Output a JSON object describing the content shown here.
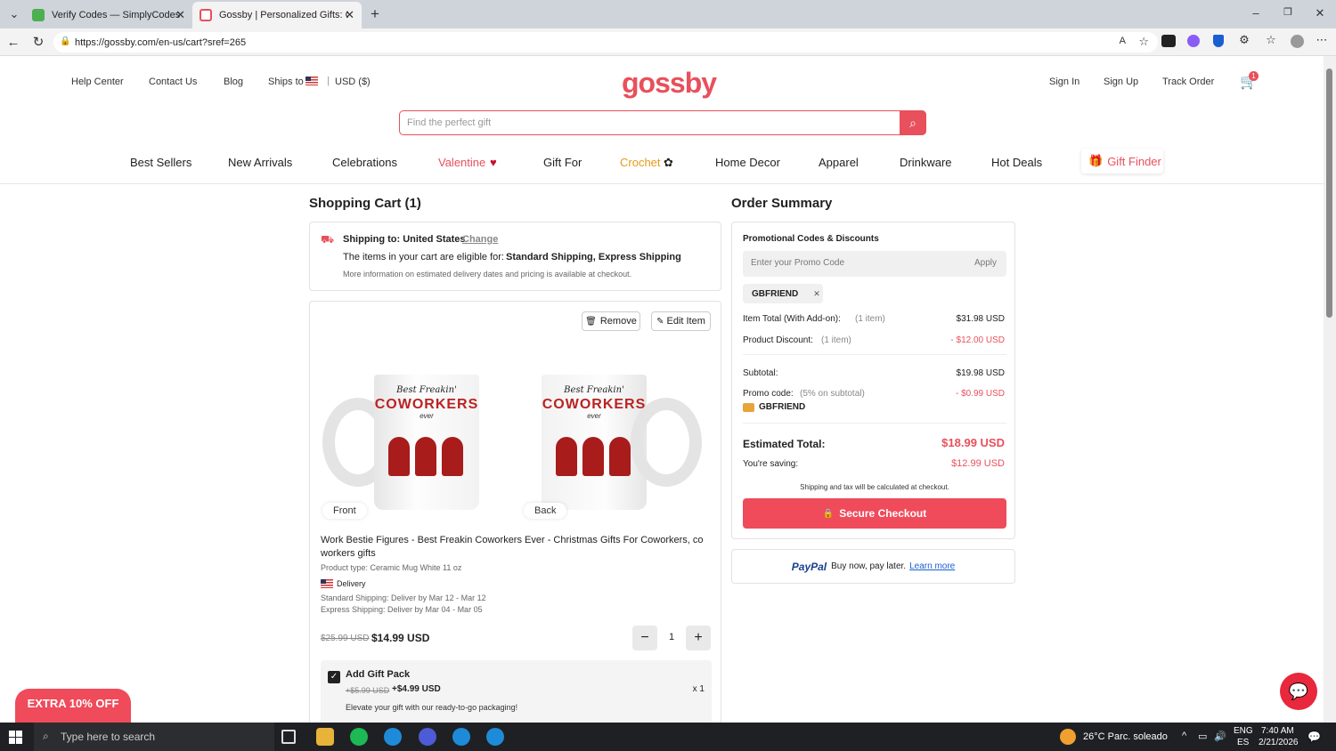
{
  "browser": {
    "tabs": [
      {
        "title": "Verify Codes — SimplyCodes"
      },
      {
        "title": "Gossby | Personalized Gifts: Custo"
      }
    ],
    "url": "https://gossby.com/en-us/cart?sref=265"
  },
  "header": {
    "links": [
      "Help Center",
      "Contact Us",
      "Blog"
    ],
    "ships_to": "Ships to",
    "currency": "USD ($)",
    "logo": "gossby",
    "account": [
      "Sign In",
      "Sign Up",
      "Track Order"
    ],
    "cart_count": "1",
    "search_placeholder": "Find the perfect gift"
  },
  "nav": {
    "items": [
      "Best Sellers",
      "New Arrivals",
      "Celebrations",
      "Valentine",
      "Gift For",
      "Crochet",
      "Home Decor",
      "Apparel",
      "Drinkware",
      "Hot Deals"
    ],
    "gift_finder": "Gift Finder"
  },
  "cart": {
    "title": "Shopping Cart (1)",
    "shipping_label": "Shipping to: United States",
    "change": "Change",
    "eligible_prefix": "The items in your cart are eligible for:",
    "eligible_methods": "Standard Shipping, Express Shipping",
    "more_info": "More information on estimated delivery dates and pricing is available at checkout.",
    "remove": "Remove",
    "edit": "Edit Item",
    "front": "Front",
    "back": "Back",
    "mug_text1": "Best Freakin'",
    "mug_text2": "COWORKERS",
    "mug_text3": "ever",
    "product_name": "Work Bestie Figures - Best Freakin Coworkers Ever - Christmas Gifts For Coworkers, co workers gifts",
    "product_type": "Product type: Ceramic Mug White 11 oz",
    "delivery": "Delivery",
    "standard": "Standard Shipping: Deliver by Mar 12 - Mar 12",
    "express": "Express Shipping: Deliver by Mar 04 - Mar 05",
    "old_price": "$25.99 USD",
    "price": "$14.99 USD",
    "qty": "1",
    "gift_title": "Add Gift Pack",
    "gift_old": "+$5.99 USD",
    "gift_price": "+$4.99 USD",
    "gift_qty": "x 1",
    "gift_desc": "Elevate your gift with our ready-to-go packaging!"
  },
  "summary": {
    "title": "Order Summary",
    "promo_title": "Promotional Codes & Discounts",
    "promo_placeholder": "Enter your Promo Code",
    "apply": "Apply",
    "code": "GBFRIEND",
    "item_total_label": "Item Total (With Add-on):",
    "item_total_note": "(1 item)",
    "item_total": "$31.98 USD",
    "discount_label": "Product Discount:",
    "discount_note": "(1 item)",
    "discount": "- $12.00 USD",
    "subtotal_label": "Subtotal:",
    "subtotal": "$19.98 USD",
    "promo_label": "Promo code:",
    "promo_note": "(5% on subtotal)",
    "promo_value": "- $0.99 USD",
    "promo_code_name": "GBFRIEND",
    "est_label": "Estimated Total:",
    "est_total": "$18.99 USD",
    "saving_label": "You're saving:",
    "saving": "$12.99 USD",
    "shipping_note": "Shipping and tax will be calculated at checkout.",
    "checkout": "Secure Checkout",
    "paypal": "PayPal",
    "paypal_text": "Buy now, pay later.",
    "learn_more": "Learn more"
  },
  "extra_off": "EXTRA 10% OFF",
  "taskbar": {
    "search": "Type here to search",
    "weather": "26°C  Parc. soleado",
    "lang1": "ENG",
    "lang2": "ES",
    "time": "7:40 AM",
    "date": "2/21/2026"
  },
  "colors": {
    "brand": "#e8505b",
    "crochet": "#e59a1a"
  }
}
